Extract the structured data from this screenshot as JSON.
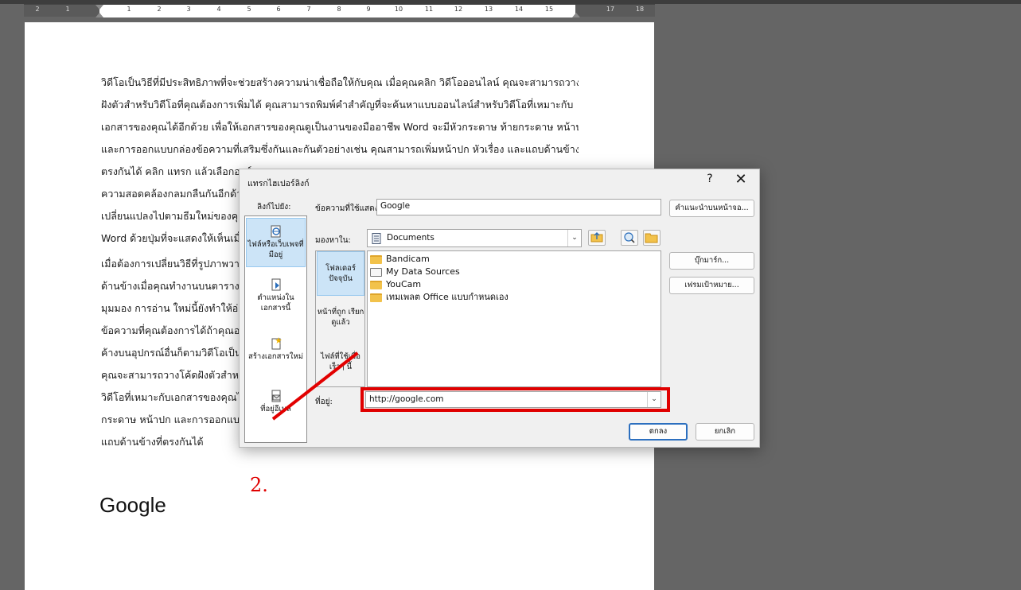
{
  "ruler": {
    "ticks": [
      "2",
      "1",
      "1",
      "2",
      "3",
      "4",
      "5",
      "6",
      "7",
      "8",
      "9",
      "10",
      "11",
      "12",
      "13",
      "14",
      "15",
      "17",
      "18"
    ]
  },
  "document": {
    "paragraph1": [
      "วิดีโอเป็นวิธีที่มีประสิทธิภาพที่จะช่วยสร้างความน่าเชื่อถือให้กับคุณ เมื่อคุณคลิก วิดีโอออนไลน์ คุณจะสามารถวางโค้ด",
      "ฝังตัวสำหรับวิดีโอที่คุณต้องการเพิ่มได้ คุณสามารถพิมพ์คำสำคัญที่จะค้นหาแบบออนไลน์สำหรับวิดีโอที่เหมาะกับ",
      "เอกสารของคุณได้อีกด้วย เพื่อให้เอกสารของคุณดูเป็นงานของมืออาชีพ Word จะมีหัวกระดาษ ท้ายกระดาษ หน้าปก",
      "และการออกแบบกล่องข้อความที่เสริมซึ่งกันและกันตัวอย่างเช่น คุณสามารถเพิ่มหน้าปก หัวเรื่อง และแถบด้านข้างที่",
      "ตรงกันได้ คลิก แทรก แล้วเลือกองค์",
      "ความสอดคล้องกลมกลืนกันอีกด้วย",
      "เปลี่ยนแปลงไปตามธีมใหม่ของคุณ",
      "Word ด้วยปุ่มที่จะแสดงให้เห็นเมื่อ"
    ],
    "paragraph2": [
      "เมื่อต้องการเปลี่ยนวิธีที่รูปภาพวาง",
      "ด้านข้างเมื่อคุณทำงานบนตาราง ใ",
      "มุมมอง การอ่าน ใหม่นี้ยังทำให้อ่าน",
      "ข้อความที่คุณต้องการได้ถ้าคุณอย",
      "ค้างบนอุปกรณ์อื่นก็ตามวิดีโอเป็นวิ",
      "คุณจะสามารถวางโค้ดฝังตัวสำหรับ",
      "วิดีโอที่เหมาะกับเอกสารของคุณได้",
      "กระดาษ หน้าปก และการออกแบบ",
      "แถบด้านข้างที่ตรงกันได้"
    ],
    "heading": "Google"
  },
  "dialog": {
    "title": "แทรกไฮเปอร์ลิงก์",
    "help": "?",
    "close": "✕",
    "link_to_label": "ลิงก์ไปยัง:",
    "link_to_items": [
      {
        "label": "ไฟล์หรือเว็บเพจที่มีอยู่",
        "icon": "web-page-icon"
      },
      {
        "label": "ตำแหน่งใน เอกสารนี้",
        "icon": "document-place-icon"
      },
      {
        "label": "สร้างเอกสารใหม่",
        "icon": "new-document-icon"
      },
      {
        "label": "ที่อยู่อีเมล",
        "icon": "email-icon"
      }
    ],
    "text_to_display_label": "ข้อความที่ใช้แสดง:",
    "text_to_display_value": "Google",
    "screentip_button": "คำแนะนำบนหน้าจอ...",
    "look_in_label": "มองหาใน:",
    "look_in_value": "Documents",
    "places": [
      "โฟลเดอร์ ปัจจุบัน",
      "หน้าที่ถูก เรียกดูแล้ว",
      "ไฟล์ที่ใช้เมื่อ เร็วๆ นี้"
    ],
    "files": [
      "Bandicam",
      "My Data Sources",
      "YouCam",
      "เทมเพลต Office แบบกำหนดเอง"
    ],
    "bookmark_button": "บุ๊กมาร์ก...",
    "target_frame_button": "เฟรมเป้าหมาย...",
    "address_label": "ที่อยู่:",
    "address_value": "http://google.com",
    "ok_button": "ตกลง",
    "cancel_button": "ยกเลิก"
  },
  "annotation": {
    "label": "2.",
    "color": "#e00000"
  }
}
